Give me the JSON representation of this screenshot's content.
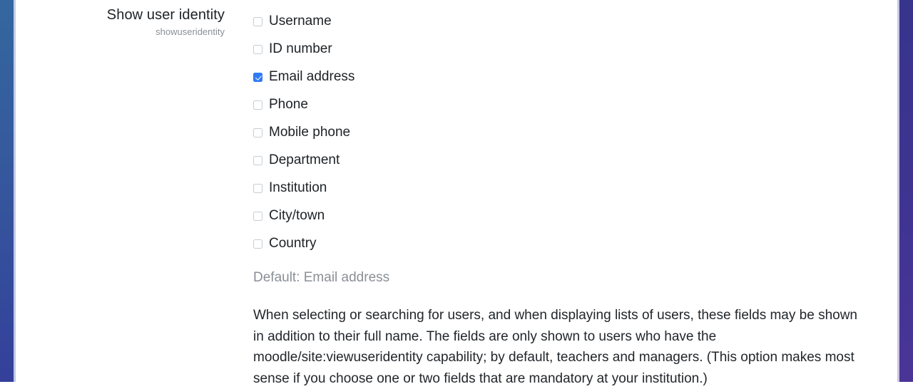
{
  "theme": {
    "left_rail_top_color": "#34679f",
    "left_rail_bottom_color": "#34409a",
    "right_rail_top_color": "#37348c",
    "right_rail_bottom_color": "#4a3597",
    "checkbox_checked_color": "#2f7bf5",
    "checkbox_border_color": "#c7cdd4",
    "text_color": "#1d2125",
    "muted_text_color": "#8a8f96"
  },
  "setting": {
    "label": "Show user identity",
    "shortname": "showuseridentity",
    "default_text": "Default: Email address",
    "description": "When selecting or searching for users, and when displaying lists of users, these fields may be shown in addition to their full name. The fields are only shown to users who have the moodle/site:viewuseridentity capability; by default, teachers and managers. (This option makes most sense if you choose one or two fields that are mandatory at your institution.)",
    "options": [
      {
        "label": "Username",
        "checked": false
      },
      {
        "label": "ID number",
        "checked": false
      },
      {
        "label": "Email address",
        "checked": true
      },
      {
        "label": "Phone",
        "checked": false
      },
      {
        "label": "Mobile phone",
        "checked": false
      },
      {
        "label": "Department",
        "checked": false
      },
      {
        "label": "Institution",
        "checked": false
      },
      {
        "label": "City/town",
        "checked": false
      },
      {
        "label": "Country",
        "checked": false
      }
    ]
  }
}
